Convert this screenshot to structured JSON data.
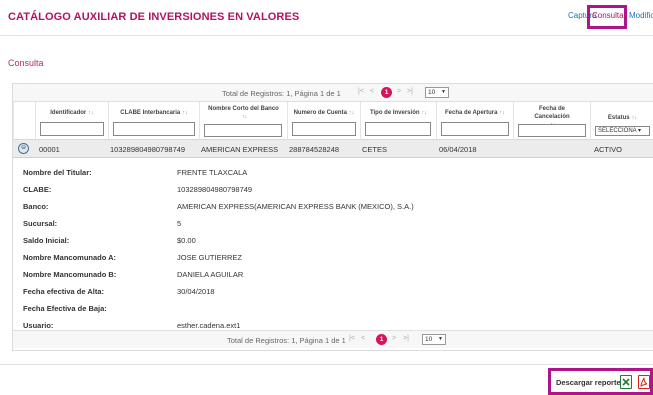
{
  "header": {
    "title": "CATÁLOGO AUXILIAR DE INVERSIONES EN VALORES",
    "nav": {
      "captura": "Captura",
      "consulta": "Consulta",
      "modificacion": "Modific"
    }
  },
  "section_title": "Consulta",
  "pager": {
    "text": "Total de Registros: 1, Página 1 de 1",
    "current_page": "1",
    "page_size": "10"
  },
  "columns": [
    {
      "label": "Identificador"
    },
    {
      "label": "CLABE Interbancaria"
    },
    {
      "label": "Nombre Corto del Banco"
    },
    {
      "label": "Numero de Cuenta"
    },
    {
      "label": "Tipo de Inversión"
    },
    {
      "label": "Fecha de Apertura"
    },
    {
      "label": "Fecha de Cancelación"
    },
    {
      "label": "Estatus"
    }
  ],
  "status_filter_value": "SELECCIONA",
  "row": {
    "identificador": "00001",
    "clabe": "103289804980798749",
    "banco": "AMERICAN EXPRESS",
    "cuenta": "288784528248",
    "tipo": "CETES",
    "apertura": "06/04/2018",
    "cancelacion": "",
    "estatus": "ACTIVO"
  },
  "details": [
    {
      "label": "Nombre del Titular:",
      "value": "FRENTE TLAXCALA"
    },
    {
      "label": "CLABE:",
      "value": "103289804980798749"
    },
    {
      "label": "Banco:",
      "value": "AMERICAN EXPRESS(AMERICAN EXPRESS BANK (MEXICO), S.A.)"
    },
    {
      "label": "Sucursal:",
      "value": "5"
    },
    {
      "label": "Saldo Inicial:",
      "value": "$0.00"
    },
    {
      "label": "Nombre Mancomunado A:",
      "value": "JOSE GUTIERREZ"
    },
    {
      "label": "Nombre Mancomunado B:",
      "value": "DANIELA AGUILAR"
    },
    {
      "label": "Fecha efectiva de Alta:",
      "value": "30/04/2018"
    },
    {
      "label": "Fecha Efectiva de Baja:",
      "value": ""
    },
    {
      "label": "Usuario:",
      "value": "esther.cadena.ext1"
    }
  ],
  "download": {
    "label": "Descargar reporte:",
    "xls_icon": "excel-icon",
    "pdf_icon": "pdf-icon"
  },
  "colors": {
    "brand": "#b0145f",
    "accent": "#d6135b",
    "highlight_box": "#b0148a",
    "link": "#1a73b8"
  }
}
